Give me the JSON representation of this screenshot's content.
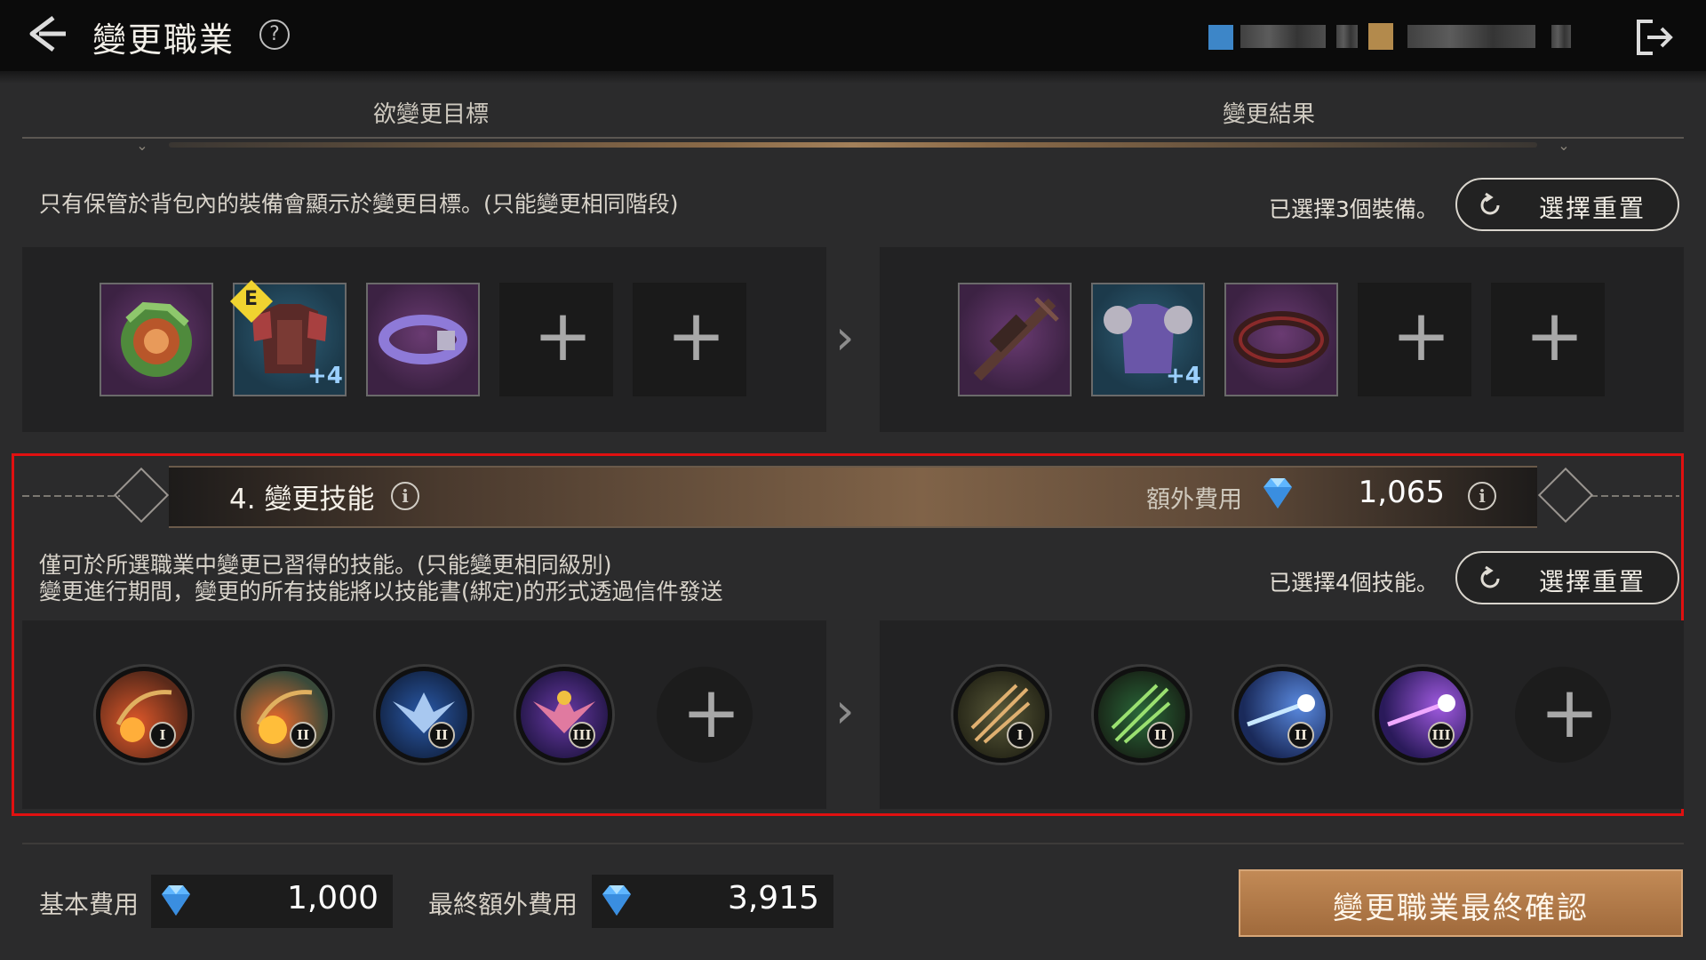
{
  "header": {
    "title": "變更職業",
    "help_icon": "?"
  },
  "columns": {
    "left": "欲變更目標",
    "right": "變更結果"
  },
  "equipment": {
    "note": "只有保管於背包內的裝備會顯示於變更目標。(只能變更相同階段)",
    "selected_text": "已選擇3個裝備。",
    "reset_label": "選擇重置",
    "source_items": [
      {
        "name": "orb",
        "bg": "purple"
      },
      {
        "name": "armor",
        "bg": "blue",
        "badge": "E",
        "plus": "+4"
      },
      {
        "name": "belt",
        "bg": "purple"
      }
    ],
    "result_items": [
      {
        "name": "crossbow",
        "bg": "purple"
      },
      {
        "name": "chain-armor",
        "bg": "blue",
        "plus": "+4"
      },
      {
        "name": "belt",
        "bg": "purple"
      }
    ],
    "plus_symbol": "+"
  },
  "skills": {
    "title": "4. 變更技能",
    "extra_fee_label": "額外費用",
    "extra_fee_value": "1,065",
    "info_icon": "i",
    "note_line1": "僅可於所選職業中變更已習得的技能。(只能變更相同級別)",
    "note_line2": "變更進行期間，變更的所有技能將以技能書(綁定)的形式透過信件發送",
    "selected_text": "已選擇4個技能。",
    "reset_label": "選擇重置",
    "source_skills": [
      {
        "name": "fire-shot",
        "rank": "I"
      },
      {
        "name": "fire-shot",
        "rank": "II"
      },
      {
        "name": "winged-emblem",
        "rank": "II"
      },
      {
        "name": "winged-emblem",
        "rank": "III"
      }
    ],
    "result_skills": [
      {
        "name": "arrow-burst",
        "rank": "I"
      },
      {
        "name": "arrow-burst",
        "rank": "II"
      },
      {
        "name": "star-arrow",
        "rank": "II"
      },
      {
        "name": "star-arrow",
        "rank": "III"
      }
    ]
  },
  "footer": {
    "base_fee_label": "基本費用",
    "base_fee_value": "1,000",
    "final_extra_label": "最終額外費用",
    "final_extra_value": "3,915",
    "confirm_label": "變更職業最終確認"
  },
  "colors": {
    "highlight": "#e01010",
    "confirm_button": "#b67a46",
    "gem": "#5fb6ff"
  }
}
